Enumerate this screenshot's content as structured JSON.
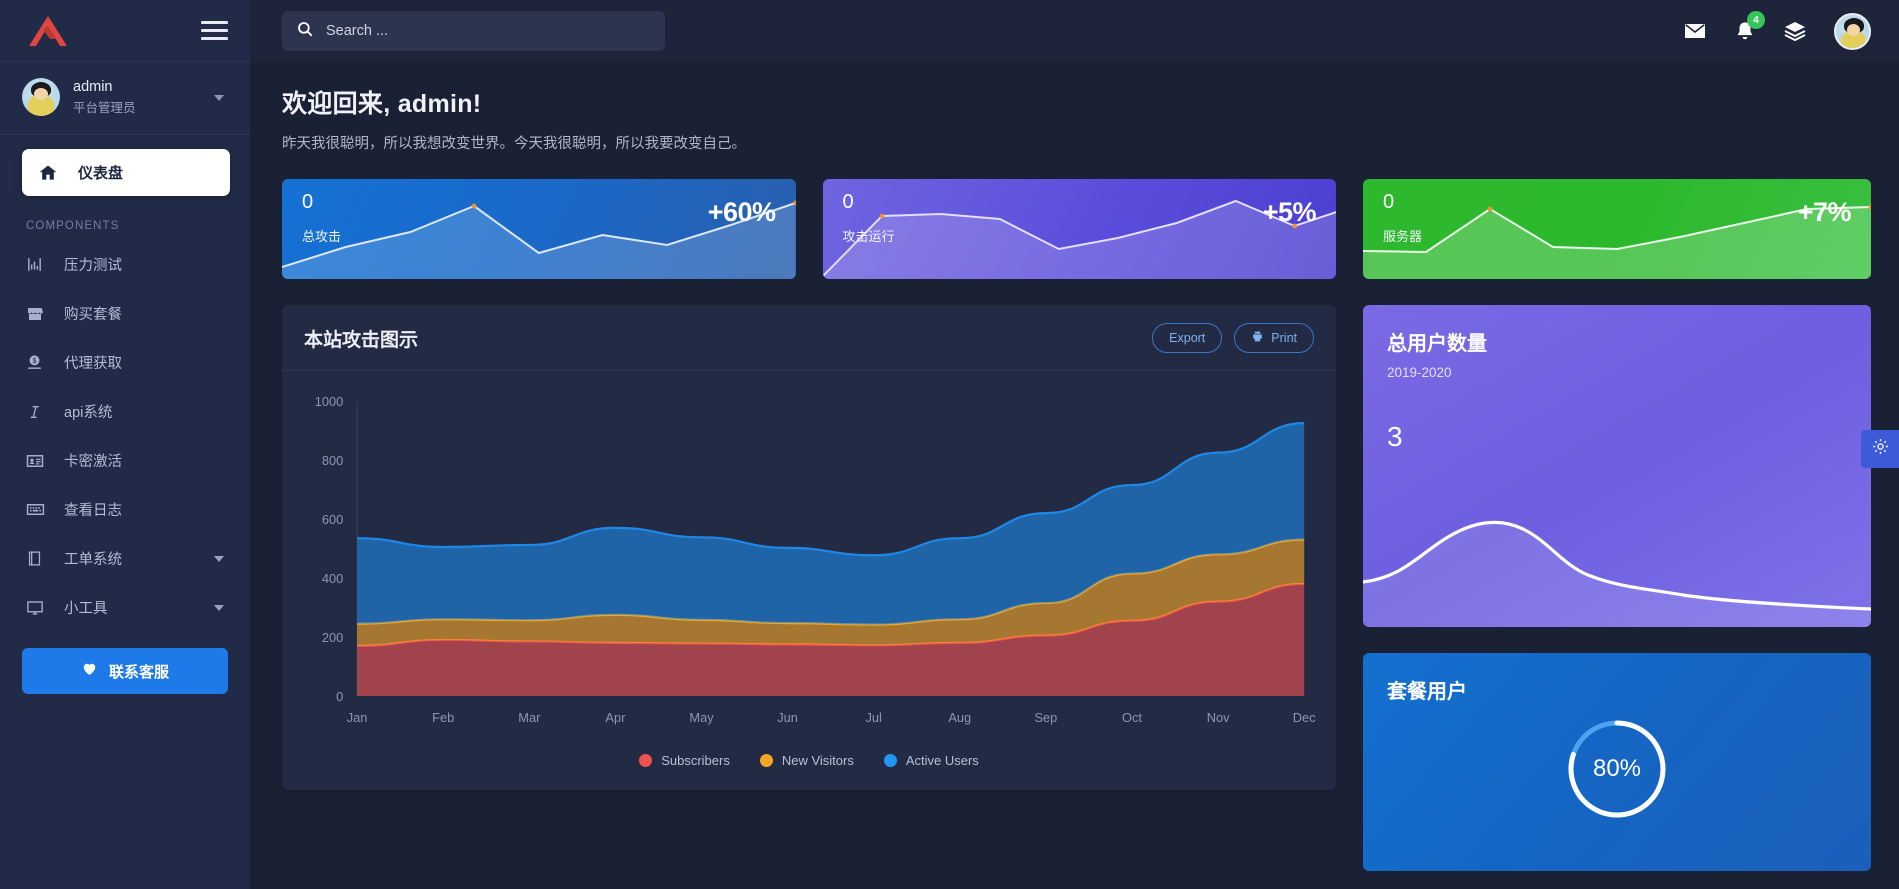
{
  "sidebar": {
    "brand_icon": "triangle-logo",
    "menu_toggle_icon": "hamburger-icon",
    "user": {
      "name": "admin",
      "role": "平台管理员",
      "avatar_icon": "user-avatar"
    },
    "active_item": {
      "label": "仪表盘",
      "icon": "home-icon"
    },
    "section_label": "COMPONENTS",
    "items": [
      {
        "label": "压力测试",
        "icon": "bar-chart-icon",
        "has_submenu": false
      },
      {
        "label": "购买套餐",
        "icon": "store-icon",
        "has_submenu": false
      },
      {
        "label": "代理获取",
        "icon": "money-icon",
        "has_submenu": false
      },
      {
        "label": "api系统",
        "icon": "italic-icon",
        "has_submenu": false
      },
      {
        "label": "卡密激活",
        "icon": "id-card-icon",
        "has_submenu": false
      },
      {
        "label": "查看日志",
        "icon": "keyboard-icon",
        "has_submenu": false
      },
      {
        "label": "工单系统",
        "icon": "book-icon",
        "has_submenu": true
      },
      {
        "label": "小工具",
        "icon": "desktop-icon",
        "has_submenu": true
      }
    ],
    "cta": {
      "label": "联系客服",
      "icon": "heart-icon",
      "color": "#1d7ae8"
    }
  },
  "topbar": {
    "search": {
      "placeholder": "Search ...",
      "value": "",
      "icon": "search-icon"
    },
    "icons": [
      {
        "name": "mail-icon"
      },
      {
        "name": "bell-icon",
        "badge": "4",
        "badge_color": "#36c75b"
      },
      {
        "name": "layers-icon"
      }
    ],
    "avatar_icon": "user-avatar"
  },
  "welcome": {
    "title": "欢迎回来, admin!",
    "subtitle": "昨天我很聪明，所以我想改变世界。今天我很聪明，所以我要改变自己。"
  },
  "stats": [
    {
      "value": "0",
      "label": "总攻击",
      "percent": "+60%",
      "color": "#1572d4"
    },
    {
      "value": "0",
      "label": "攻击运行",
      "percent": "+5%",
      "color": "#5b4ddb"
    },
    {
      "value": "0",
      "label": "服务器",
      "percent": "+7%",
      "color": "#2eb82e"
    }
  ],
  "chart_card": {
    "title": "本站攻击图示",
    "export_label": "Export",
    "print_label": "Print",
    "export_icon": "export-icon",
    "print_icon": "printer-icon"
  },
  "users_card": {
    "title": "总用户数量",
    "period": "2019-2020",
    "count": "3"
  },
  "plan_card": {
    "title": "套餐用户",
    "percent_label": "80%",
    "percent_value": 80
  },
  "settings_tab": {
    "icon": "gear-icon"
  },
  "chart_data": {
    "type": "area",
    "title": "本站攻击图示",
    "xlabel": "",
    "ylabel": "",
    "ylim": [
      0,
      1000
    ],
    "yticks": [
      0,
      200,
      400,
      600,
      800,
      1000
    ],
    "grid": false,
    "legend_position": "bottom",
    "categories": [
      "Jan",
      "Feb",
      "Mar",
      "Apr",
      "May",
      "Jun",
      "Jul",
      "Aug",
      "Sep",
      "Oct",
      "Nov",
      "Dec"
    ],
    "stacked": true,
    "series": [
      {
        "name": "Subscribers",
        "color": "#ef5350",
        "values": [
          170,
          190,
          185,
          180,
          178,
          175,
          172,
          180,
          205,
          255,
          320,
          380
        ]
      },
      {
        "name": "New Visitors",
        "color": "#f5a623",
        "values": [
          75,
          70,
          72,
          95,
          80,
          72,
          70,
          80,
          110,
          160,
          160,
          150
        ]
      },
      {
        "name": "Active Users",
        "color": "#1e88e5",
        "values": [
          290,
          245,
          255,
          295,
          280,
          255,
          235,
          275,
          305,
          300,
          345,
          395
        ]
      }
    ],
    "stat_sparklines": [
      {
        "name": "总攻击",
        "values": [
          10,
          28,
          42,
          78,
          30,
          50,
          40,
          60,
          85
        ]
      },
      {
        "name": "攻击运行",
        "values": [
          5,
          60,
          62,
          58,
          30,
          40,
          55,
          78,
          52
        ]
      },
      {
        "name": "服务器",
        "values": [
          28,
          27,
          70,
          32,
          30,
          42,
          56,
          70,
          72
        ]
      }
    ],
    "users_sparkline": {
      "name": "总用户数量",
      "values": [
        20,
        28,
        62,
        72,
        64,
        55,
        42,
        35,
        33,
        30
      ]
    }
  }
}
